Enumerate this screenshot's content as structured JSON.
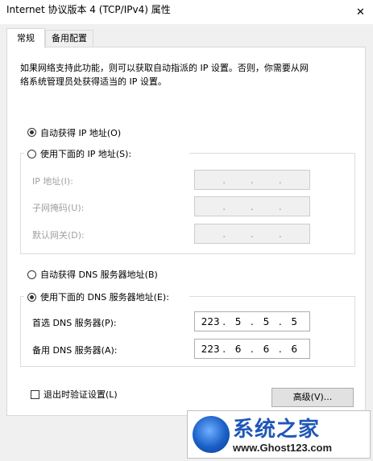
{
  "window": {
    "title": "Internet 协议版本 4 (TCP/IPv4) 属性",
    "close_icon": "close-icon"
  },
  "tabs": [
    {
      "label": "常规",
      "active": true
    },
    {
      "label": "备用配置",
      "active": false
    }
  ],
  "description": "如果网络支持此功能，则可以获取自动指派的 IP 设置。否则，你需要从网\n络系统管理员处获得适当的 IP 设置。",
  "ip": {
    "auto_label": "自动获得 IP 地址(O)",
    "manual_label": "使用下面的 IP 地址(S):",
    "selected": "auto",
    "address_label": "IP 地址(I):",
    "subnet_label": "子网掩码(U):",
    "gateway_label": "默认网关(D):"
  },
  "dns": {
    "auto_label": "自动获得 DNS 服务器地址(B)",
    "manual_label": "使用下面的 DNS 服务器地址(E):",
    "selected": "manual",
    "preferred_label": "首选 DNS 服务器(P):",
    "preferred_value": [
      "223",
      "5",
      "5",
      "5"
    ],
    "alternate_label": "备用 DNS 服务器(A):",
    "alternate_value": [
      "223",
      "6",
      "6",
      "6"
    ]
  },
  "validate_label": "退出时验证设置(L)",
  "validate_checked": false,
  "advanced_button": "高级(V)...",
  "watermark": {
    "title": "系统之家",
    "url": "www.Ghost123.com"
  }
}
